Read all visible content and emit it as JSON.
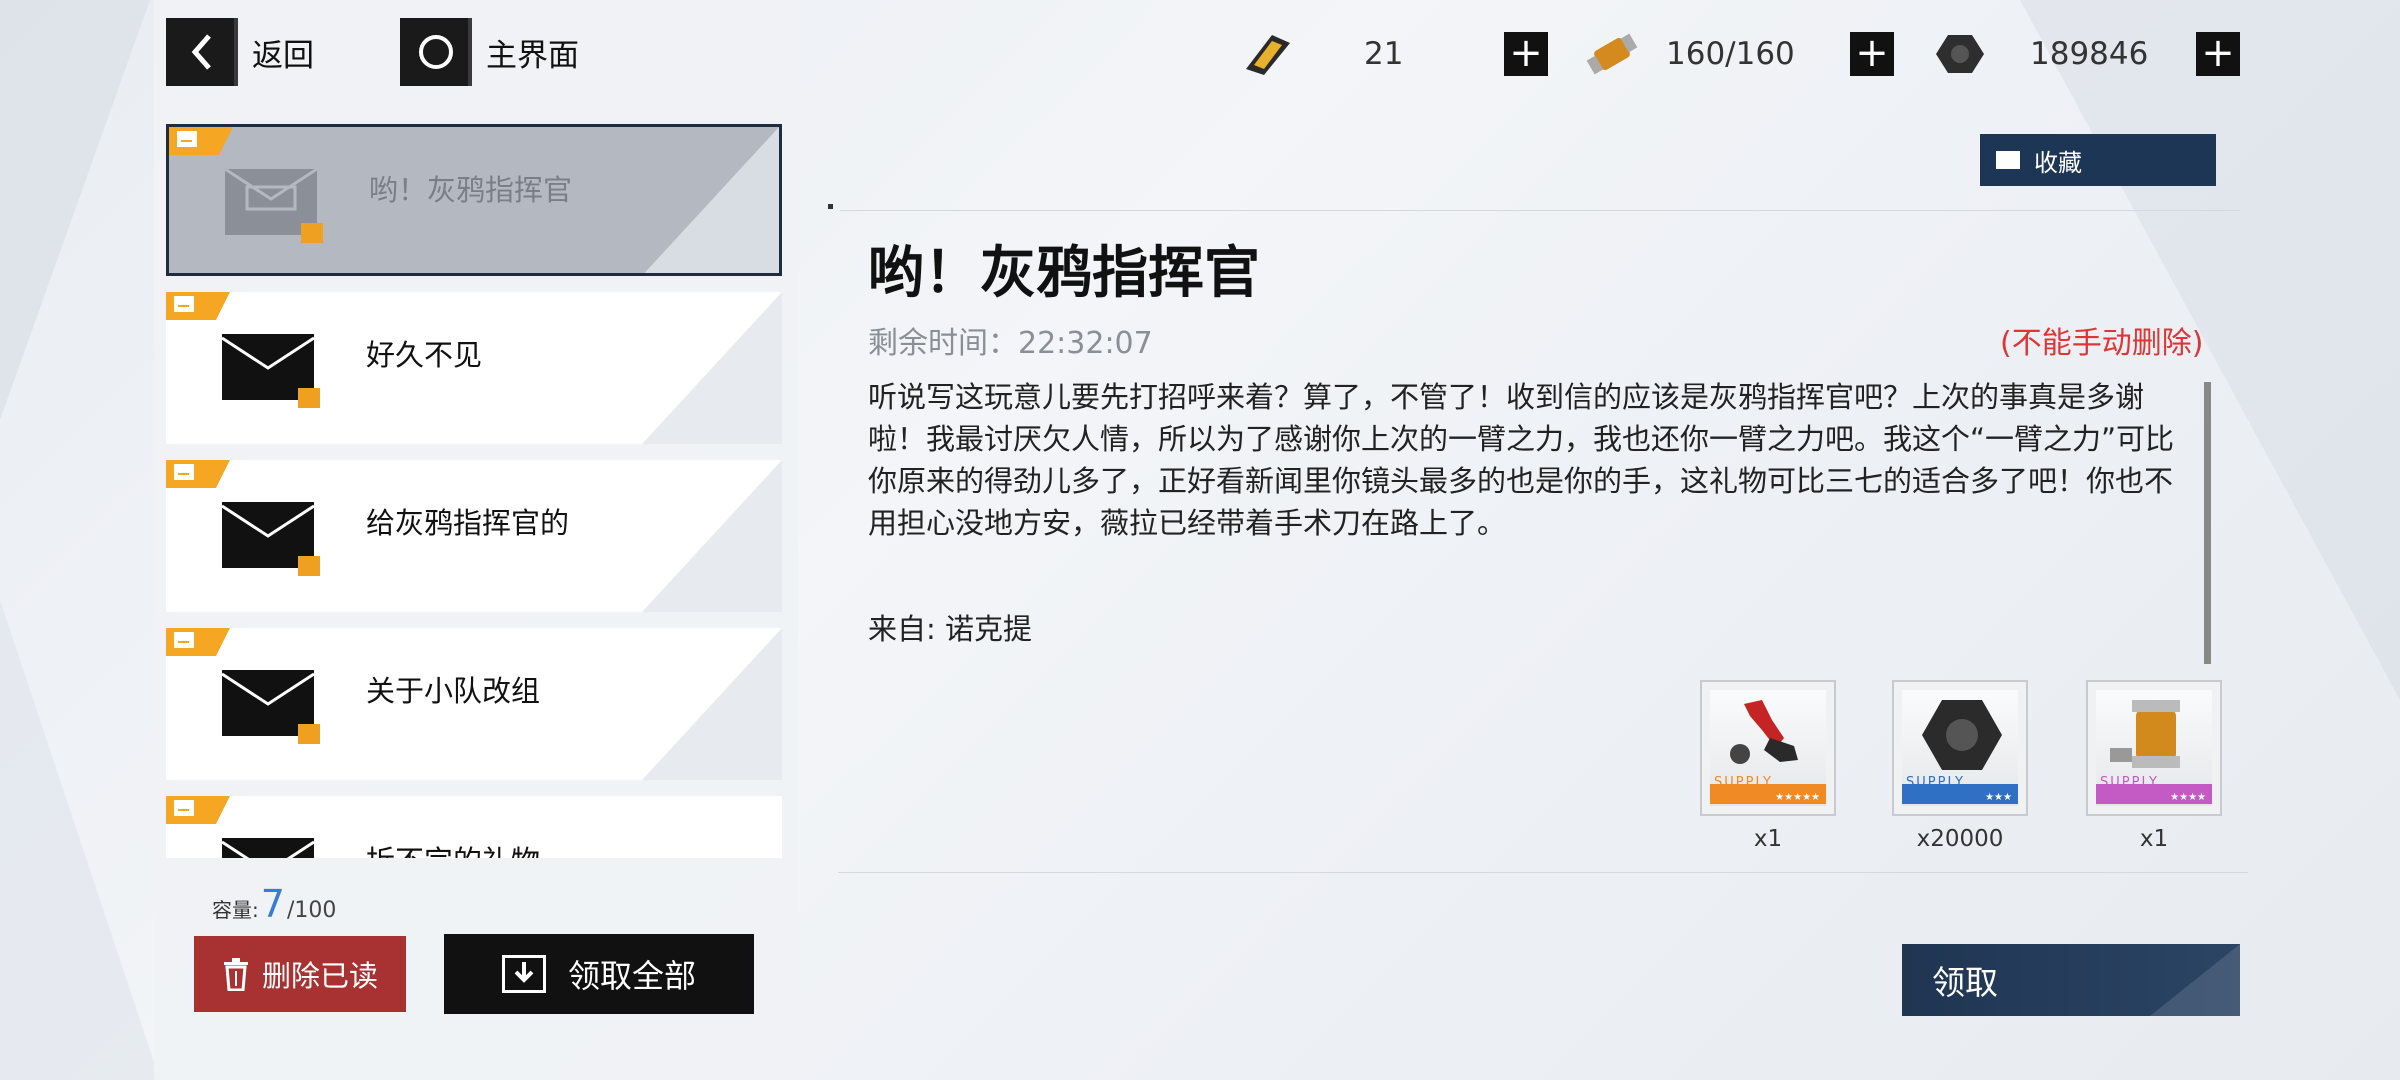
{
  "nav": {
    "back_label": "返回",
    "home_label": "主界面"
  },
  "resources": [
    {
      "icon": "battery-ticket-icon",
      "value": "21"
    },
    {
      "icon": "stamina-canister-icon",
      "value": "160/160"
    },
    {
      "icon": "hex-nut-icon",
      "value": "189846"
    }
  ],
  "mail_list": [
    {
      "title": "哟！灰鸦指挥官",
      "active": true
    },
    {
      "title": "好久不见",
      "active": false
    },
    {
      "title": "给灰鸦指挥官的",
      "active": false
    },
    {
      "title": "关于小队改组",
      "active": false
    },
    {
      "title": "拆不完的礼物",
      "active": false
    }
  ],
  "capacity": {
    "label": "容量:",
    "current": "7",
    "max": "/100"
  },
  "buttons": {
    "delete_read": "删除已读",
    "claim_all": "领取全部",
    "favorite": "收藏",
    "claim": "领取"
  },
  "mail": {
    "title": "哟！灰鸦指挥官",
    "remaining": "剩余时间：22:32:07",
    "no_delete": "(不能手动删除)",
    "body": "听说写这玩意儿要先打招呼来着？算了，不管了！收到信的应该是灰鸦指挥官吧？上次的事真是多谢啦！我最讨厌欠人情，所以为了感谢你上次的一臂之力，我也还你一臂之力吧。我这个“一臂之力”可比你原来的得劲儿多了，正好看新闻里你镜头最多的也是你的手，这礼物可比三七的适合多了吧！你也不用担心没地方安，薇拉已经带着手术刀在路上了。",
    "sender": "来自: 诺克提"
  },
  "rewards": [
    {
      "icon": "robotic-arm-icon",
      "supply": "SUPPLY",
      "stars": "★★★★★",
      "qty": "x1",
      "color": "#f08a24"
    },
    {
      "icon": "hex-nut-icon",
      "supply": "SUPPLY",
      "stars": "★★★",
      "qty": "x20000",
      "color": "#2f6fc4"
    },
    {
      "icon": "stamina-canister-icon",
      "supply": "SUPPLY",
      "stars": "★★★★",
      "qty": "x1",
      "color": "#c45ac4"
    }
  ]
}
